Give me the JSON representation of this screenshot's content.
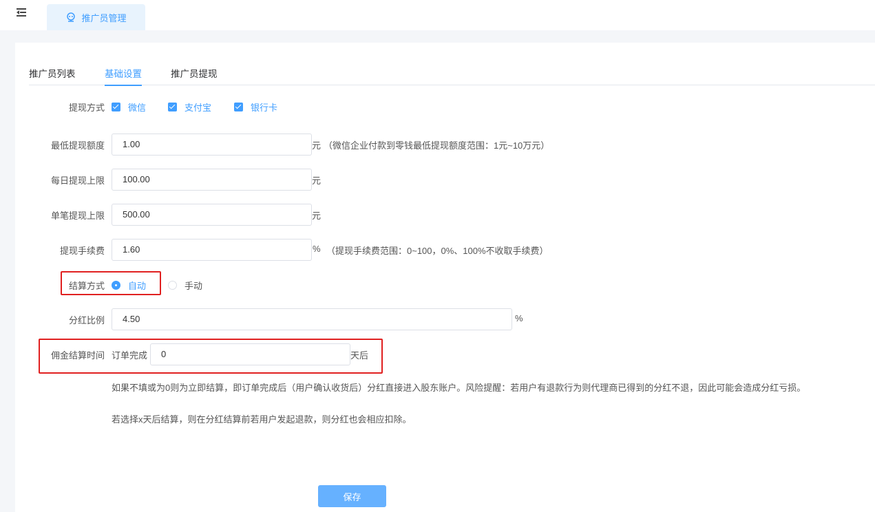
{
  "header": {
    "tab_label": "推广员管理",
    "tab_icon": "robot-icon",
    "menu_icon": "menu-fold-icon"
  },
  "tabs": [
    {
      "label": "推广员列表",
      "active": false
    },
    {
      "label": "基础设置",
      "active": true
    },
    {
      "label": "推广员提现",
      "active": false
    }
  ],
  "form": {
    "withdraw_method": {
      "label": "提现方式",
      "options": [
        {
          "label": "微信",
          "checked": true
        },
        {
          "label": "支付宝",
          "checked": true
        },
        {
          "label": "银行卡",
          "checked": true
        }
      ]
    },
    "min_amount": {
      "label": "最低提现额度",
      "value": "1.00",
      "unit": "元",
      "hint": "（微信企业付款到零钱最低提现额度范围：1元~10万元）"
    },
    "daily_limit": {
      "label": "每日提现上限",
      "value": "100.00",
      "unit": "元"
    },
    "single_limit": {
      "label": "单笔提现上限",
      "value": "500.00",
      "unit": "元"
    },
    "fee": {
      "label": "提现手续费",
      "value": "1.60",
      "unit": "%",
      "hint": "（提现手续费范围：0~100，0%、100%不收取手续费）"
    },
    "settle_method": {
      "label": "结算方式",
      "options": [
        {
          "label": "自动",
          "selected": true
        },
        {
          "label": "手动",
          "selected": false
        }
      ]
    },
    "dividend_ratio": {
      "label": "分红比例",
      "value": "4.50",
      "unit": "%"
    },
    "commission_time": {
      "label": "佣金结算时间",
      "prefix": "订单完成",
      "value": "0",
      "suffix": "天后"
    },
    "notes": [
      "如果不填或为0则为立即结算，即订单完成后（用户确认收货后）分红直接进入股东账户。风险提醒：若用户有退款行为则代理商已得到的分红不退，因此可能会造成分红亏损。",
      "若选择x天后结算，则在分红结算前若用户发起退款，则分红也会相应扣除。"
    ],
    "save_label": "保存"
  },
  "colors": {
    "accent": "#409eff",
    "highlight_border": "#e02020"
  }
}
